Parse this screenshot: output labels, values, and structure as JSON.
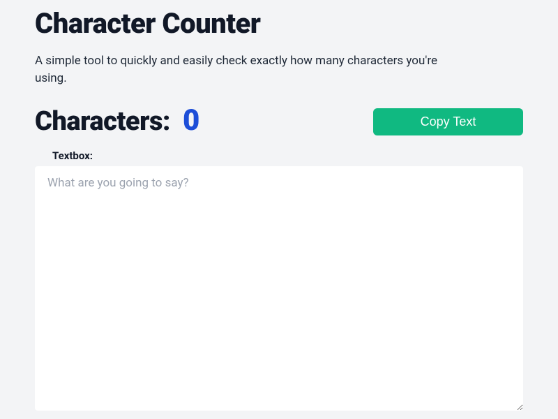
{
  "header": {
    "title": "Character Counter",
    "description": "A simple tool to quickly and easily check exactly how many characters you're using."
  },
  "counter": {
    "label": "Characters:",
    "value": "0"
  },
  "actions": {
    "copy_label": "Copy Text"
  },
  "textbox": {
    "label": "Textbox:",
    "placeholder": "What are you going to say?",
    "value": ""
  }
}
